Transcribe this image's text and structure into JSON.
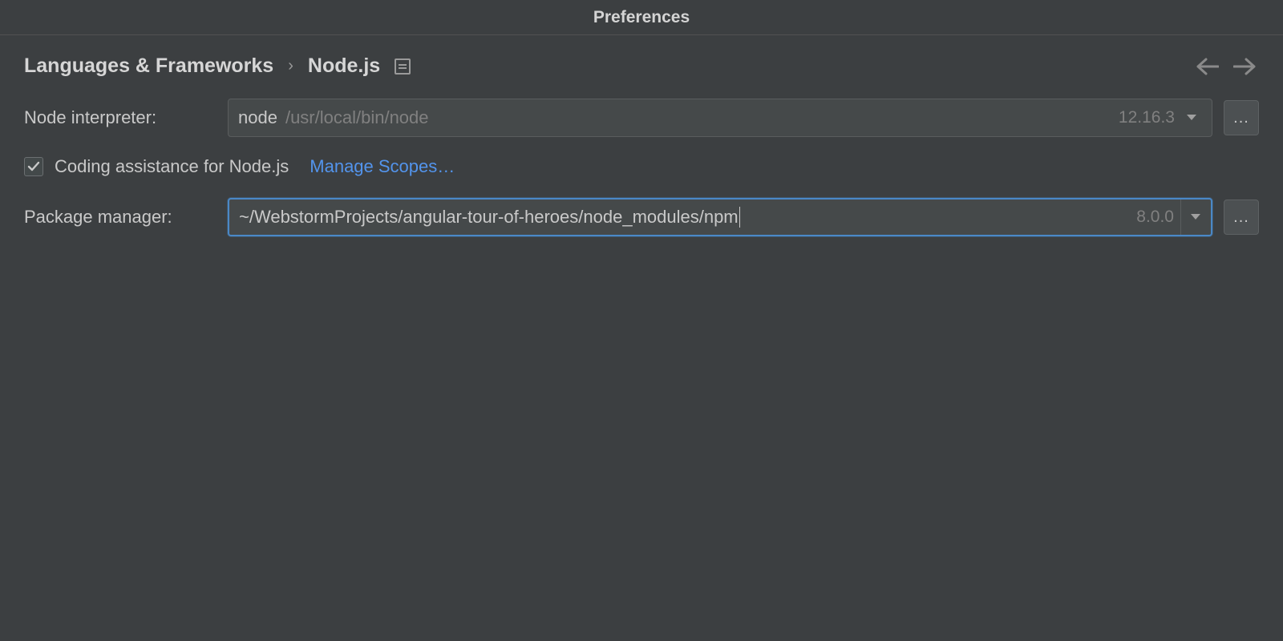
{
  "window": {
    "title": "Preferences"
  },
  "breadcrumb": {
    "parent": "Languages & Frameworks",
    "separator": "›",
    "current": "Node.js"
  },
  "fields": {
    "node_interpreter": {
      "label": "Node interpreter:",
      "prefix": "node",
      "path": "/usr/local/bin/node",
      "version": "12.16.3"
    },
    "coding_assistance": {
      "label": "Coding assistance for Node.js",
      "checked": true,
      "manage_scopes_label": "Manage Scopes…"
    },
    "package_manager": {
      "label": "Package manager:",
      "value": "~/WebstormProjects/angular-tour-of-heroes/node_modules/npm",
      "version": "8.0.0"
    }
  },
  "buttons": {
    "browse": "..."
  }
}
